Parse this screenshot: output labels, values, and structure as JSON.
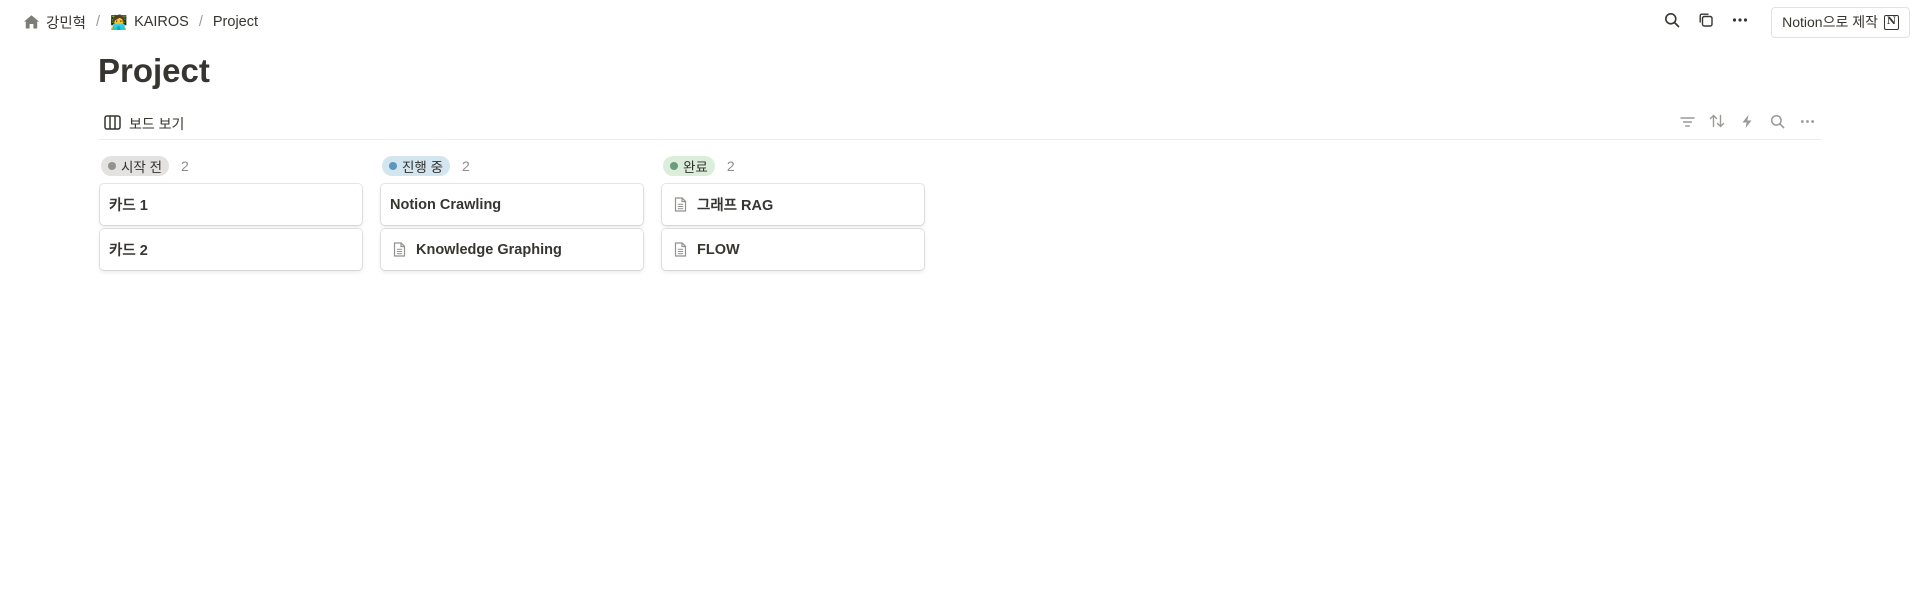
{
  "breadcrumb": {
    "home_label": "강민혁",
    "workspace_emoji": "🧑‍💻",
    "workspace_label": "KAIROS",
    "page_label": "Project",
    "separator": "/"
  },
  "topbar": {
    "made_with_label": "Notion으로 제작",
    "notion_mark": "N"
  },
  "page": {
    "title": "Project"
  },
  "view": {
    "tab_label": "보드 보기"
  },
  "board": {
    "columns": [
      {
        "label": "시작 전",
        "count": "2",
        "pill_color": "#e3e2e0",
        "dot_color": "#91918e",
        "cards": [
          {
            "title": "카드 1",
            "icon": ""
          },
          {
            "title": "카드 2",
            "icon": ""
          }
        ]
      },
      {
        "label": "진행 중",
        "count": "2",
        "pill_color": "#d3e5ef",
        "dot_color": "#5b97bd",
        "cards": [
          {
            "title": "Notion Crawling",
            "icon": ""
          },
          {
            "title": "Knowledge Graphing",
            "icon": "page-icon"
          }
        ]
      },
      {
        "label": "완료",
        "count": "2",
        "pill_color": "#dbeddb",
        "dot_color": "#6c9b7d",
        "cards": [
          {
            "title": "그래프 RAG",
            "icon": "page-icon"
          },
          {
            "title": "FLOW",
            "icon": "page-icon"
          }
        ]
      }
    ]
  }
}
